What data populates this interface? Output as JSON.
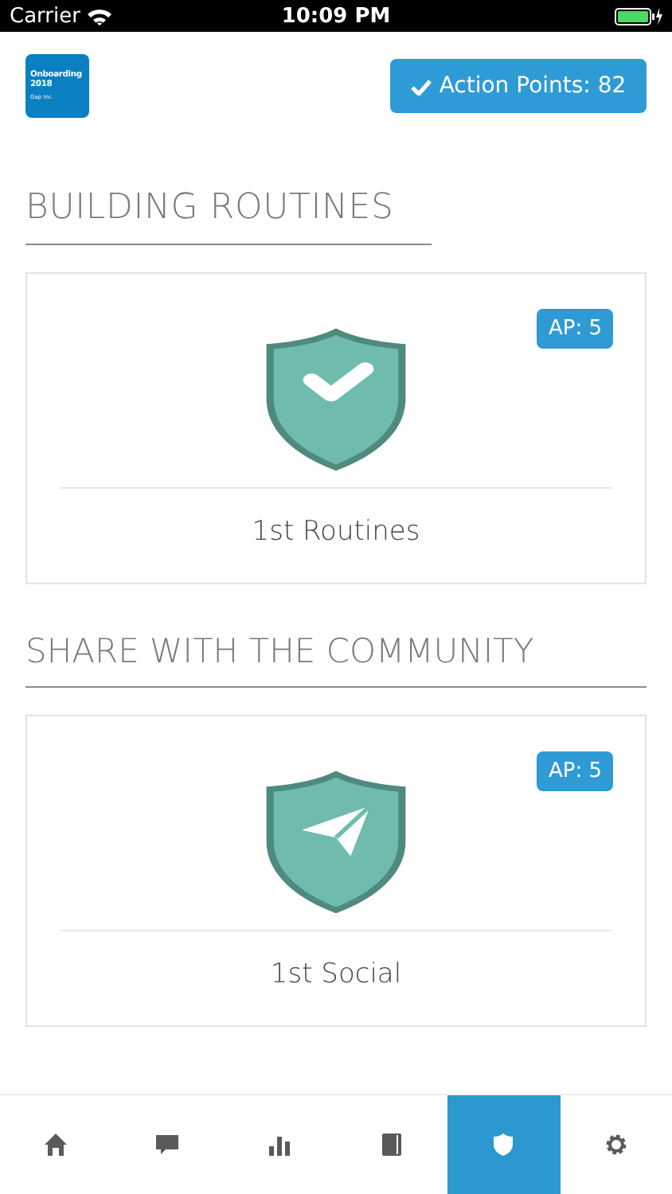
{
  "status_bar": {
    "carrier": "Carrier",
    "time": "10:09 PM"
  },
  "header": {
    "logo": {
      "title": "Onboarding 2018",
      "subtitle": "Gap Inc."
    },
    "action_points_button": "Action Points: 82"
  },
  "sections": [
    {
      "title": "BUILDING ROUTINES",
      "cards": [
        {
          "title": "1st Routines",
          "badge": "AP: 5"
        }
      ]
    },
    {
      "title": "SHARE WITH THE COMMUNITY",
      "cards": [
        {
          "title": "1st Social",
          "badge": "AP: 5"
        }
      ]
    }
  ],
  "tab_bar": [
    {
      "selected": false
    },
    {
      "selected": false
    },
    {
      "selected": false
    },
    {
      "selected": false
    },
    {
      "selected": true
    },
    {
      "selected": false
    }
  ]
}
